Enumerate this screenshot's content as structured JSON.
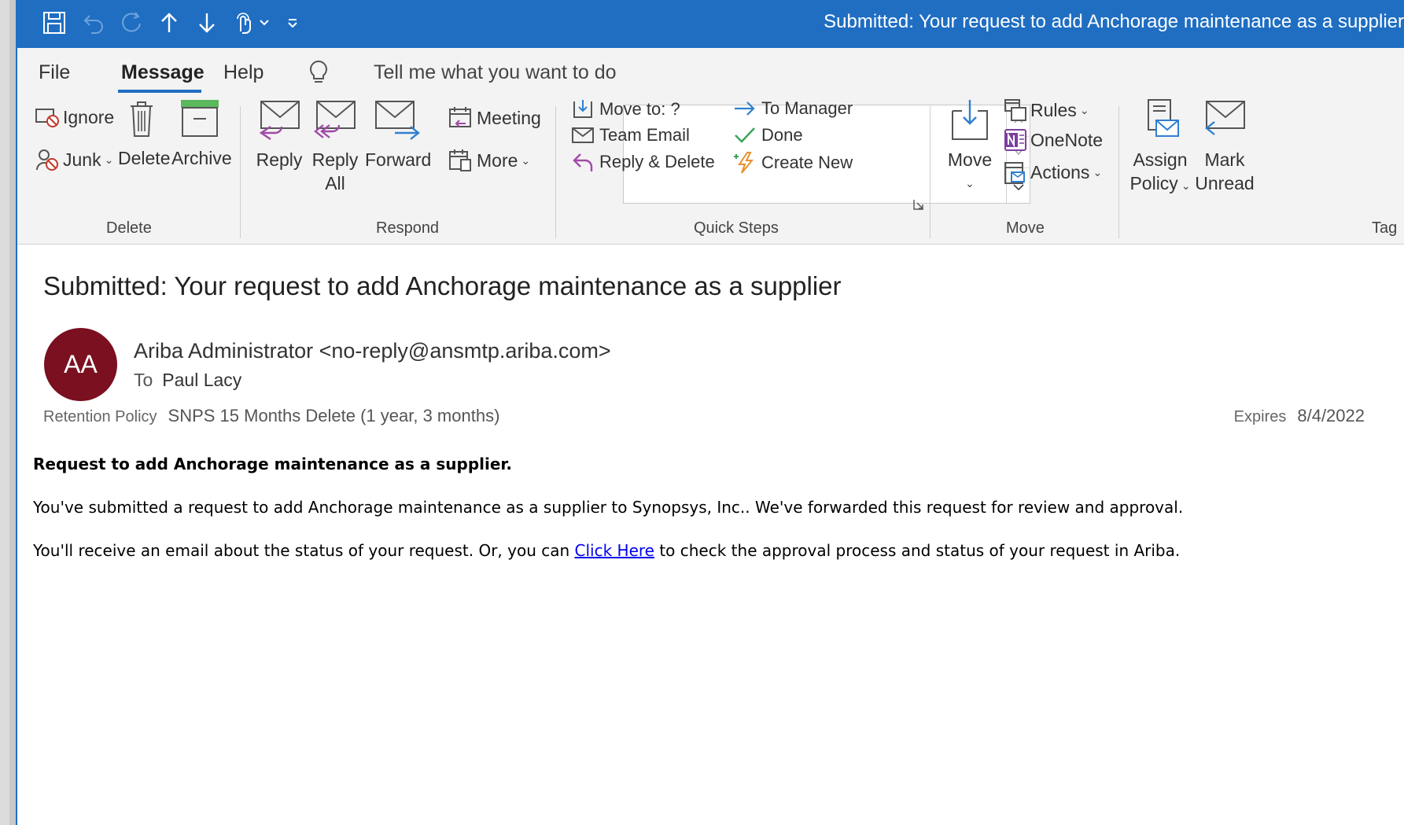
{
  "window": {
    "title": "Submitted: Your request to add Anchorage maintenance as a supplier"
  },
  "tabs": {
    "file": "File",
    "message": "Message",
    "help": "Help",
    "tell_me": "Tell me what you want to do"
  },
  "ribbon": {
    "delete_group": {
      "label": "Delete",
      "ignore": "Ignore",
      "junk": "Junk",
      "delete": "Delete",
      "archive": "Archive"
    },
    "respond_group": {
      "label": "Respond",
      "reply": "Reply",
      "reply_all_1": "Reply",
      "reply_all_2": "All",
      "forward": "Forward",
      "meeting": "Meeting",
      "more": "More"
    },
    "quick_steps_group": {
      "label": "Quick Steps",
      "move_to": "Move to: ?",
      "team_email": "Team Email",
      "reply_delete": "Reply & Delete",
      "to_manager": "To Manager",
      "done": "Done",
      "create_new": "Create New"
    },
    "move_group": {
      "label": "Move",
      "move": "Move",
      "rules": "Rules",
      "onenote": "OneNote",
      "actions": "Actions"
    },
    "tags_group": {
      "label": "Tag",
      "assign_policy_1": "Assign",
      "assign_policy_2": "Policy",
      "mark_unread_1": "Mark",
      "mark_unread_2": "Unread"
    }
  },
  "message": {
    "subject": "Submitted: Your request to add Anchorage maintenance as a supplier",
    "avatar_initials": "AA",
    "sender": "Ariba Administrator <no-reply@ansmtp.ariba.com>",
    "to_label": "To",
    "to_value": "Paul Lacy",
    "retention_label": "Retention Policy",
    "retention_value": "SNPS 15 Months Delete (1 year, 3 months)",
    "expires_label": "Expires",
    "expires_value": "8/4/2022",
    "body": {
      "heading": "Request to add Anchorage maintenance as a supplier.",
      "line1": "You've submitted a request to add Anchorage maintenance as a supplier to Synopsys, Inc.. We've forwarded this request for review and approval.",
      "line2_pre": "You'll receive an email about the status of your request. Or, you can ",
      "line2_link": "Click Here",
      "line2_post": " to check the approval process and status of your request in Ariba."
    }
  },
  "colors": {
    "titlebar": "#1f6ec2",
    "avatar": "#7a1020",
    "ribbon_bg": "#f3f3f3",
    "purple_icon": "#a04aa8",
    "blue_icon": "#2f7fd0",
    "link": "#0000ee"
  }
}
